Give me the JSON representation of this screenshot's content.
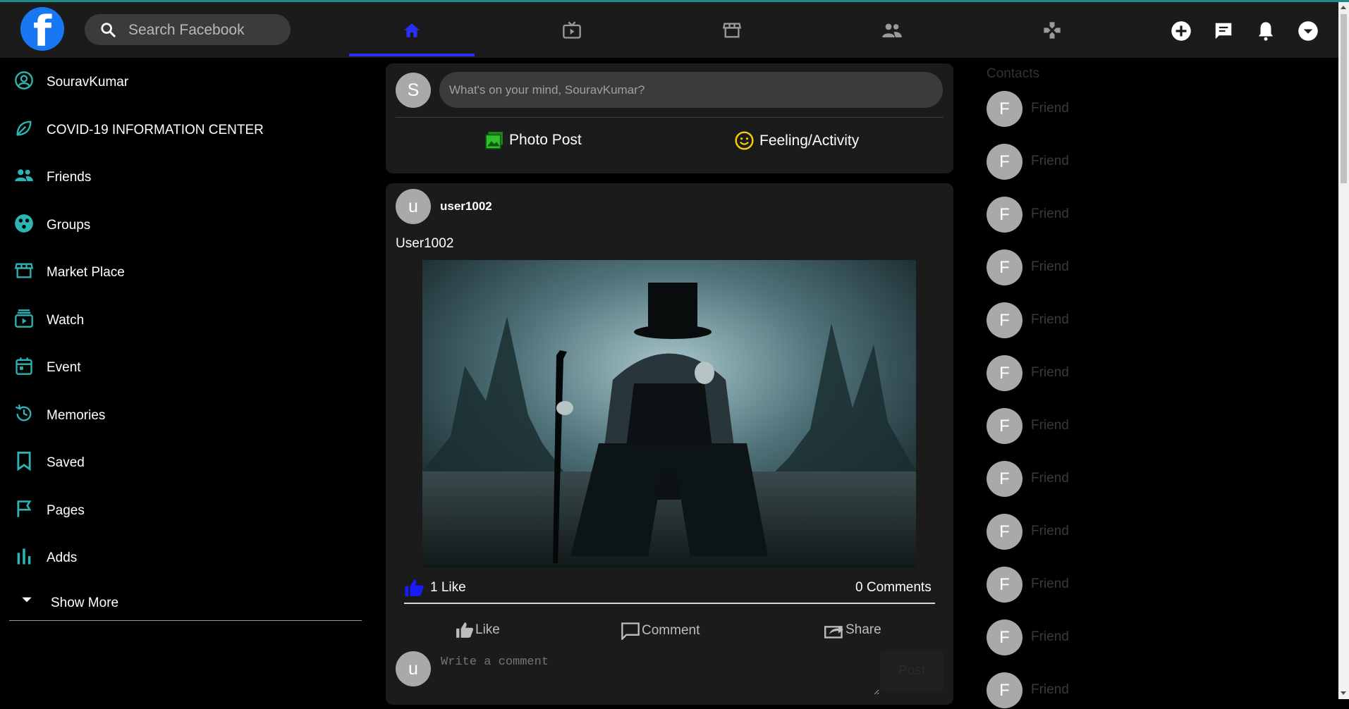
{
  "header": {
    "logo_letter": "f",
    "search_placeholder": "Search Facebook",
    "nav_tabs": [
      {
        "icon": "home-icon",
        "active": true
      },
      {
        "icon": "watch-icon",
        "active": false
      },
      {
        "icon": "marketplace-icon",
        "active": false
      },
      {
        "icon": "groups-icon",
        "active": false
      },
      {
        "icon": "gaming-icon",
        "active": false
      }
    ],
    "right_icons": [
      "plus-circle-icon",
      "messenger-icon",
      "bell-icon",
      "chevron-down-icon"
    ]
  },
  "sidebar": {
    "items": [
      {
        "label": "SouravKumar",
        "icon": "user-circle-icon"
      },
      {
        "label": "COVID-19 INFORMATION CENTER",
        "icon": "leaf-icon"
      },
      {
        "label": "Friends",
        "icon": "friends-icon"
      },
      {
        "label": "Groups",
        "icon": "groups-icon"
      },
      {
        "label": "Market Place",
        "icon": "store-icon"
      },
      {
        "label": "Watch",
        "icon": "video-icon"
      },
      {
        "label": "Event",
        "icon": "calendar-icon"
      },
      {
        "label": "Memories",
        "icon": "history-icon"
      },
      {
        "label": "Saved",
        "icon": "bookmark-icon"
      },
      {
        "label": "Pages",
        "icon": "flag-icon"
      },
      {
        "label": "Adds",
        "icon": "bar-chart-icon"
      }
    ],
    "show_more": "Show More"
  },
  "composer": {
    "avatar_letter": "S",
    "placeholder": "What's on your mind, SouravKumar?",
    "photo_label": "Photo Post",
    "feeling_label": "Feeling/Activity"
  },
  "post": {
    "avatar_letter": "u",
    "username": "user1002",
    "caption": "User1002",
    "likes_text": "1 Like",
    "comments_text": "0 Comments",
    "like_button": "Like",
    "comment_button": "Comment",
    "share_button": "Share",
    "comment_avatar_letter": "u",
    "comment_placeholder": "Write a comment",
    "post_button": "Post"
  },
  "contacts": {
    "title": "Contacts",
    "items": [
      {
        "letter": "F",
        "name": "Friend"
      },
      {
        "letter": "F",
        "name": "Friend"
      },
      {
        "letter": "F",
        "name": "Friend"
      },
      {
        "letter": "F",
        "name": "Friend"
      },
      {
        "letter": "F",
        "name": "Friend"
      },
      {
        "letter": "F",
        "name": "Friend"
      },
      {
        "letter": "F",
        "name": "Friend"
      },
      {
        "letter": "F",
        "name": "Friend"
      },
      {
        "letter": "F",
        "name": "Friend"
      },
      {
        "letter": "F",
        "name": "Friend"
      },
      {
        "letter": "F",
        "name": "Friend"
      },
      {
        "letter": "F",
        "name": "Friend"
      }
    ]
  },
  "colors": {
    "accent_teal": "#2bb5b5",
    "active_tab": "#2b2ef5",
    "like_blue": "#1a1aff"
  }
}
